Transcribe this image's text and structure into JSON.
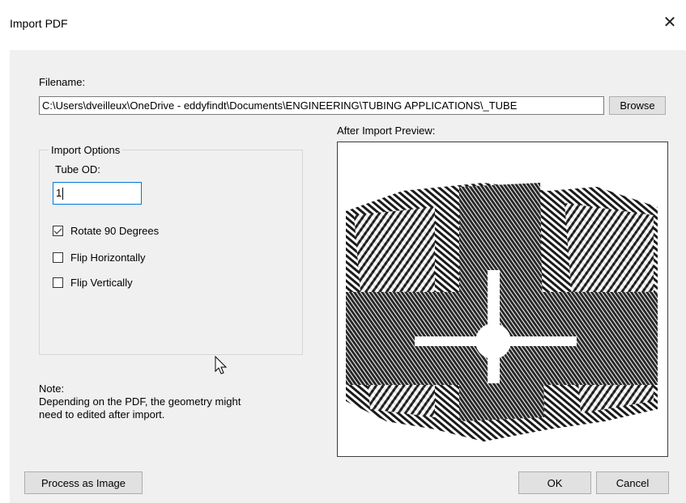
{
  "window": {
    "title": "Import PDF",
    "close_glyph": "✕"
  },
  "filename": {
    "label": "Filename:",
    "value": "C:\\Users\\dveilleux\\OneDrive - eddyfindt\\Documents\\ENGINEERING\\TUBING APPLICATIONS\\_TUBE",
    "browse_label": "Browse"
  },
  "import_options": {
    "legend": "Import Options",
    "tube_od_label": "Tube OD:",
    "tube_od_value": "1",
    "checkboxes": [
      {
        "label": "Rotate 90 Degrees",
        "checked": true
      },
      {
        "label": "Flip Horizontally",
        "checked": false
      },
      {
        "label": "Flip Vertically",
        "checked": false
      }
    ]
  },
  "preview": {
    "label": "After Import Preview:"
  },
  "note": {
    "heading": "Note:",
    "line1": "Depending on the PDF, the geometry might",
    "line2": "need to edited after import."
  },
  "buttons": {
    "process_image": "Process as Image",
    "ok": "OK",
    "cancel": "Cancel"
  }
}
